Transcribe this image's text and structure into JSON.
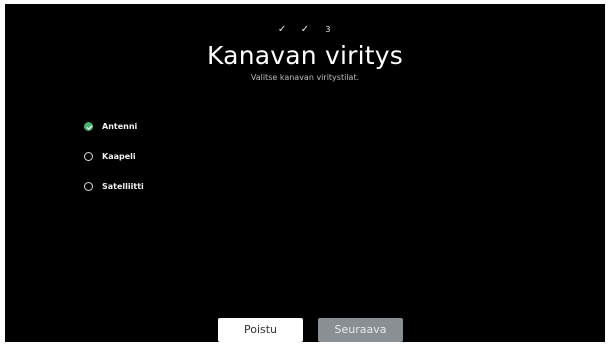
{
  "progress": {
    "steps": [
      {
        "label": "✓",
        "state": "done"
      },
      {
        "label": "✓",
        "state": "done"
      },
      {
        "label": "3",
        "state": "current"
      }
    ]
  },
  "header": {
    "title": "Kanavan viritys",
    "subtitle": "Valitse kanavan viritystilat."
  },
  "options": [
    {
      "label": "Antenni",
      "selected": true
    },
    {
      "label": "Kaapeli",
      "selected": false
    },
    {
      "label": "Satelliitti",
      "selected": false
    }
  ],
  "buttons": {
    "remove_label": "Poistu",
    "next_label": "Seuraava"
  },
  "colors": {
    "background": "#000000",
    "selected": "#4caf72",
    "next_button": "#8a8f94"
  }
}
